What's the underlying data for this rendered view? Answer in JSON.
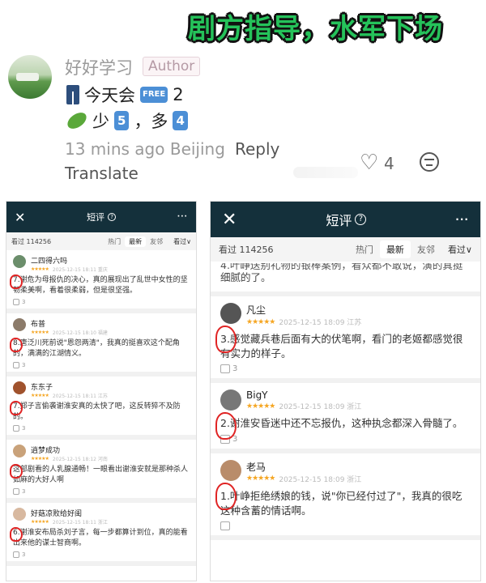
{
  "headline": "剧方指导，水军下场",
  "comment": {
    "username": "好好学习",
    "author_tag": "Author",
    "line1_text": "今天会",
    "free_badge": "FREE",
    "line1_num": "2",
    "line2_text": "少",
    "line2_k1": "5",
    "line2_sep": "，多",
    "line2_k2": "4",
    "meta": "13 mins ago Beijing",
    "reply": "Reply",
    "translate": "Translate",
    "likes": "4"
  },
  "left_phone": {
    "close": "✕",
    "title": "短评",
    "qmark": "?",
    "more": "···",
    "seen": "看过 114256",
    "tabs": [
      "热门",
      "最新",
      "友邻"
    ],
    "sort": "看过∨",
    "reviews": [
      {
        "name": "二四得六吗",
        "stars": "★★★★★",
        "date": "2025-12-15 18:11 重庆",
        "text": "7.谢危为母报仇的决心，真的展现出了乱世中女性的坚韧柔美啊，看着很柔弱，但是很坚强。",
        "likes": "3"
      },
      {
        "name": "布普",
        "stars": "★★★★★",
        "date": "2025-12-15 18:10 福建",
        "text": "8.唐泛川死前说\"恩怨两清\"，我真的挺喜欢这个配角的，满满的江湖情义。",
        "likes": "3"
      },
      {
        "name": "东东子",
        "stars": "★★★★★",
        "date": "2025-12-15 18:11 江苏",
        "text": "7.郑子言偷袭谢淮安真的太快了吧，这反转猝不及防的。",
        "likes": "3"
      },
      {
        "name": "逍梦成功",
        "stars": "★★★★★",
        "date": "2025-12-15 18:12 河南",
        "text": "这部剧看的人乳腺通畅！一眼看出谢淮安就是那种杀人如麻的大好人啊",
        "likes": "3"
      },
      {
        "name": "好菇凉败给好闺",
        "stars": "★★★★★",
        "date": "2025-12-15 18:11 浙江",
        "text": "6.谢淮安布局杀刘子言，每一步都算计到位，真的能看出来他的谋士智商啊。",
        "likes": "3"
      }
    ]
  },
  "right_phone": {
    "close": "✕",
    "title": "短评",
    "qmark": "?",
    "more": "···",
    "seen": "看过 114256",
    "tabs": [
      "热门",
      "最新",
      "友邻"
    ],
    "sort": "看过∨",
    "cut_text": "4.叶峥送别礼物的银棒案例，看众都不敢说，演的真挺",
    "cut_tail": "细腻的了。",
    "reviews": [
      {
        "name": "凡尘",
        "stars": "★★★★★",
        "date": "2025-12-15 18:09 江苏",
        "text": "3.感觉藏兵巷后面有大的伏笔啊，看门的老姬都感觉很有实力的样子。",
        "likes": "3"
      },
      {
        "name": "BigY",
        "stars": "★★★★★",
        "date": "2025-12-15 18:09 浙江",
        "text": "2.谢淮安昏迷中还不忘报仇，这种执念都深入骨髓了。",
        "likes": "3"
      },
      {
        "name": "老马",
        "stars": "★★★★★",
        "date": "2025-12-15 18:09 浙江",
        "text": "1.叶峥拒绝绣娘的钱，说\"你已经付过了\"，我真的很吃这种含蓄的情话啊。",
        "likes": ""
      }
    ]
  },
  "colors": {
    "headline_green": "#25c25a",
    "header_dark": "#14303b",
    "star": "#f5a623",
    "annotation_red": "#e02424",
    "keycap_blue": "#4c8fd6"
  }
}
